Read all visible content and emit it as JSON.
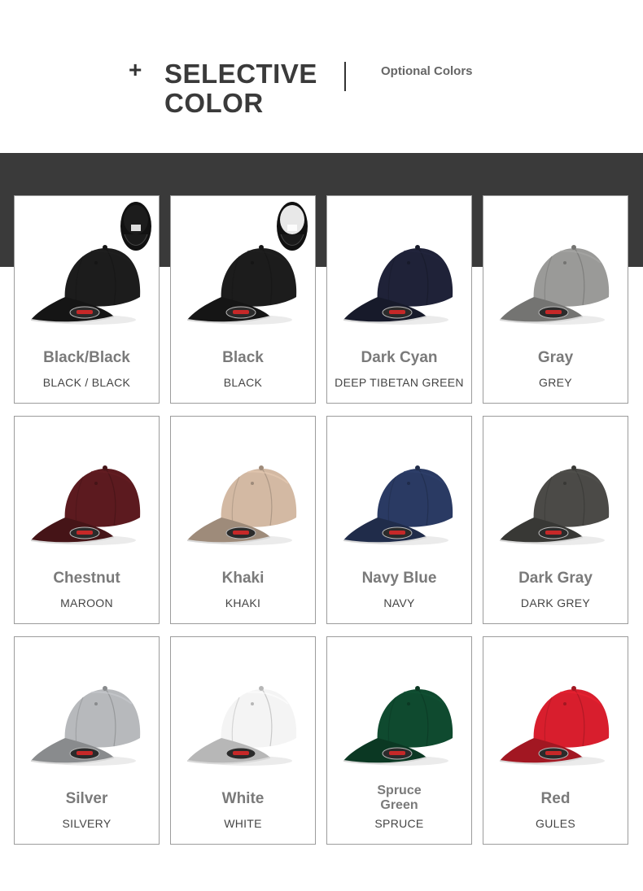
{
  "header": {
    "plus": "+",
    "title_line1": "SELECTIVE",
    "title_line2": "COLOR",
    "subtitle": "Optional Colors"
  },
  "cards": [
    {
      "name": "Black/Black",
      "code": "BLACK / BLACK",
      "color": "#1c1c1c",
      "inner": "#1c1c1c"
    },
    {
      "name": "Black",
      "code": "BLACK",
      "color": "#1c1c1c",
      "inner": "#e8e8e8"
    },
    {
      "name": "Dark Cyan",
      "code": "DEEP TIBETAN GREEN",
      "color": "#1f2238"
    },
    {
      "name": "Gray",
      "code": "GREY",
      "color": "#9a9a98"
    },
    {
      "name": "Chestnut",
      "code": "MAROON",
      "color": "#5c1a1f"
    },
    {
      "name": "Khaki",
      "code": "KHAKI",
      "color": "#d3b9a3"
    },
    {
      "name": "Navy Blue",
      "code": "NAVY",
      "color": "#2a3a63"
    },
    {
      "name": "Dark Gray",
      "code": "DARK GREY",
      "color": "#4b4a47"
    },
    {
      "name": "Silver",
      "code": "SILVERY",
      "color": "#b7b9bc"
    },
    {
      "name": "White",
      "code": "WHITE",
      "color": "#f4f4f4"
    },
    {
      "name": "Spruce Green",
      "code": "SPRUCE",
      "color": "#0f4a2f"
    },
    {
      "name": "Red",
      "code": "GULES",
      "color": "#d81e2d"
    }
  ]
}
